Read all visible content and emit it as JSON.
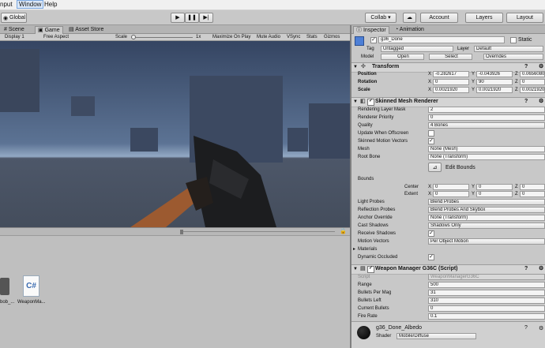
{
  "menubar": {
    "items": [
      "nput",
      "Window",
      "Help"
    ]
  },
  "toolbar": {
    "pivot": "Global",
    "collab": "Collab ▾",
    "account": "Account",
    "layers": "Layers",
    "layout": "Layout"
  },
  "tabs": {
    "scene": "Scene",
    "game": "Game",
    "asset_store": "Asset Store",
    "inspector": "Inspector",
    "animation": "Animation"
  },
  "gamebar": {
    "display": "Display 1",
    "aspect": "Free Aspect",
    "scale_label": "Scale",
    "scale_value": "1x",
    "maximize": "Maximize On Play",
    "mute": "Mute Audio",
    "vsync": "VSync",
    "stats": "Stats",
    "gizmos": "Gizmos"
  },
  "project": {
    "items": [
      {
        "label": "bob_..."
      },
      {
        "label": "WeaponMa..."
      }
    ]
  },
  "inspector": {
    "object_name": "g36_Done",
    "static_label": "Static",
    "tag_label": "Tag",
    "tag_value": "Untagged",
    "layer_label": "Layer",
    "layer_value": "Default",
    "model_label": "Model",
    "open": "Open",
    "select": "Select",
    "overrides": "Overrides",
    "transform": {
      "title": "Transform",
      "position_label": "Position",
      "position": [
        "-0.282617",
        "-0.043926",
        "0.0656080"
      ],
      "rotation_label": "Rotation",
      "rotation": [
        "0",
        "90",
        "0"
      ],
      "scale_label": "Scale",
      "scale": [
        "0.0021920",
        "0.0021920",
        "0.0021920"
      ]
    },
    "smr": {
      "title": "Skinned Mesh Renderer",
      "rendering_layer_mask": "Rendering Layer Mask",
      "rendering_layer_mask_value": "2",
      "renderer_priority": "Renderer Priority",
      "renderer_priority_value": "0",
      "quality": "Quality",
      "quality_value": "4 Bones",
      "update_offscreen": "Update When Offscreen",
      "skinned_motion": "Skinned Motion Vectors",
      "mesh": "Mesh",
      "mesh_value": "None (Mesh)",
      "root_bone": "Root Bone",
      "root_bone_value": "None (Transform)",
      "edit_bounds": "Edit Bounds",
      "bounds": "Bounds",
      "center": "Center",
      "extent": "Extent",
      "center_values": [
        "0",
        "0",
        "0"
      ],
      "extent_values": [
        "0",
        "0",
        "0"
      ],
      "light_probes": "Light Probes",
      "light_probes_value": "Blend Probes",
      "reflection_probes": "Reflection Probes",
      "reflection_probes_value": "Blend Probes And Skybox",
      "anchor_override": "Anchor Override",
      "anchor_override_value": "None (Transform)",
      "cast_shadows": "Cast Shadows",
      "cast_shadows_value": "Shadows Only",
      "receive_shadows": "Receive Shadows",
      "motion_vectors": "Motion Vectors",
      "motion_vectors_value": "Per Object Motion",
      "materials": "Materials",
      "dynamic_occluded": "Dynamic Occluded"
    },
    "weapon": {
      "title": "Weapon Manager G36C (Script)",
      "script": "Script",
      "script_value": "WeaponManagerG36C",
      "range": "Range",
      "range_value": "500",
      "bpm": "Bullets Per Mag",
      "bpm_value": "31",
      "bullets_left": "Bullets Left",
      "bullets_left_value": "310",
      "current_bullets": "Current Bullets",
      "current_bullets_value": "0",
      "fire_rate": "Fire Rate",
      "fire_rate_value": "0.1"
    },
    "material": {
      "name": "g36_Done_Albedo",
      "shader_label": "Shader",
      "shader_value": "Mobile/Diffuse"
    }
  },
  "colors": {
    "sky_top": "#3d4f6b",
    "sky_horizon": "#8ea5c2",
    "ground": "#4c5665",
    "cube": "#3b4860",
    "accent": "#4d7fd6"
  }
}
